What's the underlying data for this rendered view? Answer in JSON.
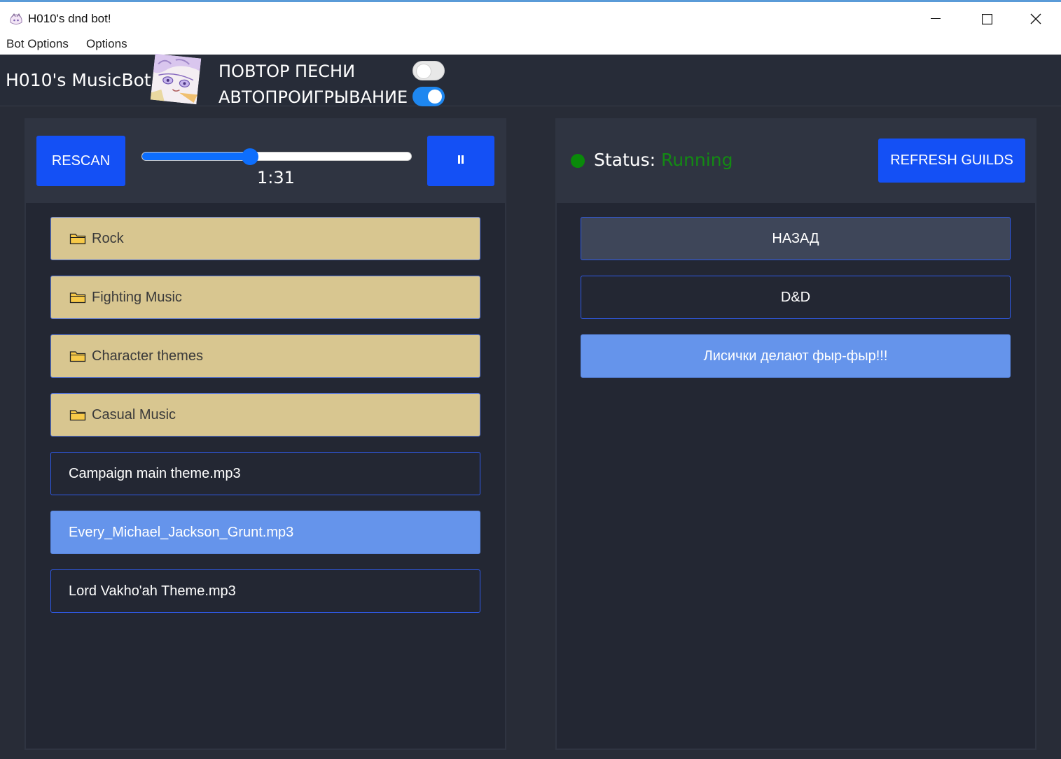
{
  "window": {
    "title": "H010's dnd bot!",
    "controls": [
      "minimize-icon",
      "maximize-icon",
      "close-icon"
    ]
  },
  "menu": {
    "items": [
      "Bot Options",
      "Options"
    ]
  },
  "header": {
    "brand": "H010's MusicBot",
    "toggles": [
      {
        "label": "ПОВТОР ПЕСНИ",
        "on": false
      },
      {
        "label": "АВТОПРОИГРЫВАНИЕ",
        "on": true
      }
    ]
  },
  "player": {
    "rescan_label": "RESCAN",
    "time": "1:31",
    "progress": 0.4,
    "pause_icon": "pause-icon",
    "accent": "#1450f5"
  },
  "library": {
    "folders": [
      "Rock",
      "Fighting Music",
      "Character themes",
      "Casual Music"
    ],
    "files": [
      "Campaign main theme.mp3",
      "Every_Michael_Jackson_Grunt.mp3",
      "Lord Vakho'ah Theme.mp3"
    ],
    "selected_file": "Every_Michael_Jackson_Grunt.mp3"
  },
  "guilds_panel": {
    "status_label": "Status:",
    "status_value": "Running",
    "status_color": "#138a13",
    "refresh_label": "REFRESH GUILDS",
    "back_label": "НАЗАД",
    "items": [
      "D&D",
      "Лисички делают фыр-фыр!!!"
    ],
    "selected": "Лисички делают фыр-фыр!!!"
  }
}
